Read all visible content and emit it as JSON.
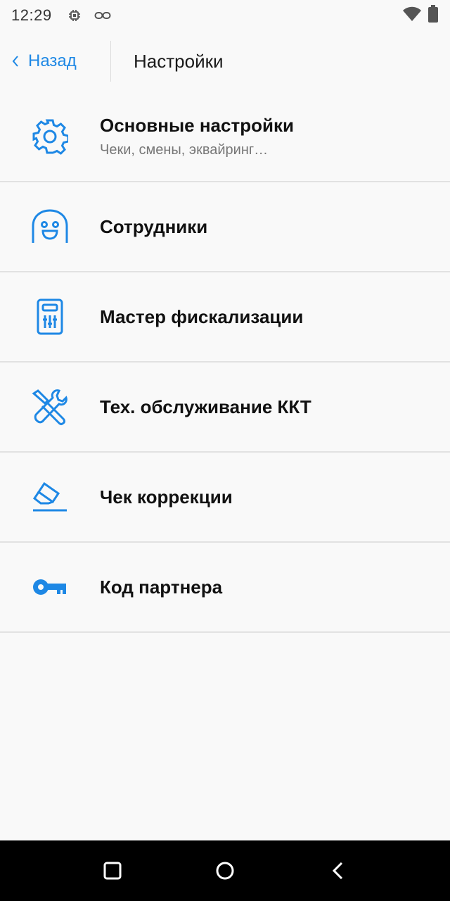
{
  "status_bar": {
    "time": "12:29",
    "icons": [
      "cpu-icon",
      "link-icon",
      "wifi-icon",
      "battery-icon"
    ]
  },
  "header": {
    "back_label": "Назад",
    "title": "Настройки"
  },
  "accent_color": "#1e88e5",
  "menu": [
    {
      "label": "Основные настройки",
      "subtitle": "Чеки, смены, эквайринг…",
      "icon": "gear-icon"
    },
    {
      "label": "Сотрудники",
      "icon": "employee-face-icon"
    },
    {
      "label": "Мастер фискализации",
      "icon": "fiscal-device-icon"
    },
    {
      "label": "Тех. обслуживание ККТ",
      "icon": "tools-icon"
    },
    {
      "label": "Чек коррекции",
      "icon": "eraser-icon"
    },
    {
      "label": "Код партнера",
      "icon": "key-icon"
    }
  ],
  "nav_bar": {
    "buttons": [
      "recents-icon",
      "home-icon",
      "back-nav-icon"
    ]
  }
}
